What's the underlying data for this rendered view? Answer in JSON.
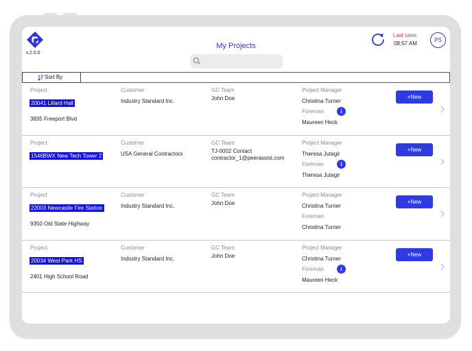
{
  "app": {
    "version": "v.2.0.0",
    "title": "My Projects",
    "last_save_label": "Last save:",
    "last_save_time": "08:57 AM",
    "user_initials": "PS",
    "accent": "#2f36d6",
    "alert_color": "#e0393e"
  },
  "search": {
    "placeholder": "",
    "icon": "search-icon"
  },
  "toolbar": {
    "sort_label": "Sort By"
  },
  "columns": {
    "project": "Project",
    "customer": "Customer",
    "gc_team": "GC Team",
    "project_manager": "Project Manager",
    "foreman": "Foreman"
  },
  "new_label": "+New",
  "projects": [
    {
      "name": "20041 Lillard Hall",
      "address": "3835 Freeport Blvd",
      "customer": "Industry Standard Inc.",
      "gc_team_1": "John Doe",
      "gc_team_2": "",
      "manager": "Christina Turner",
      "foreman": "Maureen Heck",
      "info": "i"
    },
    {
      "name": "1546BWX New Tech Tower 2",
      "address": "",
      "customer": "USA General Contractors",
      "gc_team_1": "TJ-0002 Contact",
      "gc_team_2": "contractor_1@peerassist.com",
      "manager": "Theresa Jutagir",
      "foreman": "Theresa Jutagir",
      "info": "i"
    },
    {
      "name": "22003 Newcastle Fire Station",
      "address": "9350 Old State Highway",
      "customer": "Industry Standard Inc.",
      "gc_team_1": "John Doe",
      "gc_team_2": "",
      "manager": "Christina Turner",
      "foreman": "Christina Turner",
      "info": ""
    },
    {
      "name": "20034 West Park HS",
      "address": "2401 High School Road",
      "customer": "Industry Standard Inc.",
      "gc_team_1": "John Doe",
      "gc_team_2": "",
      "manager": "Christina Turner",
      "foreman": "Maureen Heck",
      "info": "i"
    }
  ]
}
